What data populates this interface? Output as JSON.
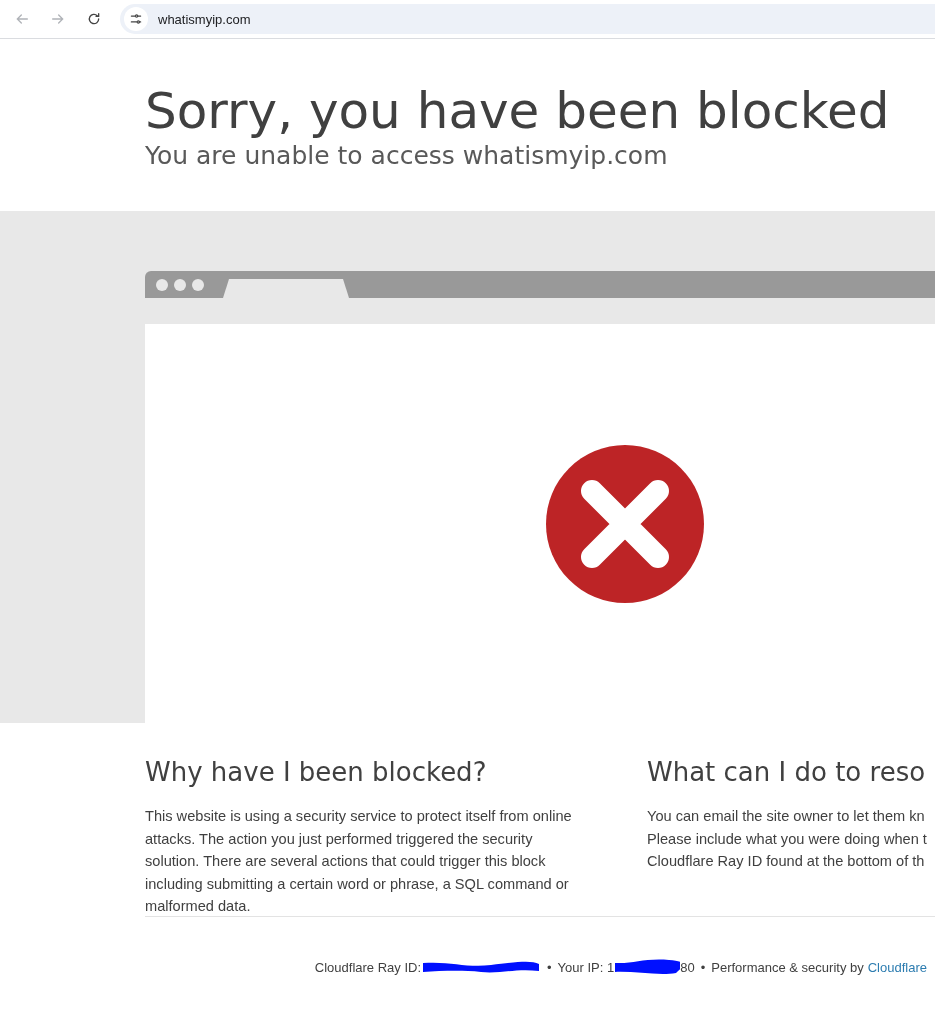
{
  "browser": {
    "url": "whatismyip.com"
  },
  "header": {
    "title": "Sorry, you have been blocked",
    "subtitle": "You are unable to access whatismyip.com"
  },
  "sections": [
    {
      "heading": "Why have I been blocked?",
      "lines": [
        "This website is using a security service to protect itself from online",
        "attacks. The action you just performed triggered the security",
        "solution. There are several actions that could trigger this block",
        "including submitting a certain word or phrase, a SQL command or",
        "malformed data."
      ]
    },
    {
      "heading": "What can I do to reso",
      "lines": [
        "You can email the site owner to let them kn",
        "Please include what you were doing when t",
        "Cloudflare Ray ID found at the bottom of th"
      ]
    }
  ],
  "footer": {
    "ray_label": "Cloudflare Ray ID:",
    "separator_1": "•",
    "ip_label": "Your IP:",
    "ip_prefix": "1",
    "ip_tail": "80",
    "separator_2": "•",
    "performance": "Performance & security by",
    "link": "Cloudflare"
  }
}
